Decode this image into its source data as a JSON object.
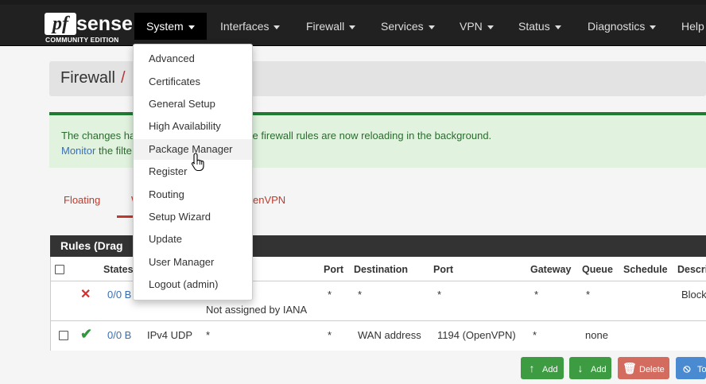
{
  "brand": {
    "logo_pf": "pf",
    "logo_sense": "sense",
    "edition": "COMMUNITY EDITION"
  },
  "nav": {
    "items": [
      {
        "label": "System",
        "active": true
      },
      {
        "label": "Interfaces"
      },
      {
        "label": "Firewall"
      },
      {
        "label": "Services"
      },
      {
        "label": "VPN"
      },
      {
        "label": "Status"
      },
      {
        "label": "Diagnostics"
      },
      {
        "label": "Help"
      }
    ]
  },
  "breadcrumb": {
    "title": "Firewall",
    "separator": "/"
  },
  "alert": {
    "line1_start": "The changes ha",
    "line1_end": "fully. The firewall rules are now reloading in the background.",
    "line2_link": "Monitor",
    "line2_rest": " the filte"
  },
  "tabs": {
    "floating": "Floating",
    "wan_partial": "W",
    "openvpn_partial": "enVPN"
  },
  "rules": {
    "panel_title": "Rules (Drag",
    "headers": {
      "states": "States",
      "port1": "Port",
      "destination": "Destination",
      "port2": "Port",
      "gateway": "Gateway",
      "queue": "Queue",
      "schedule": "Schedule",
      "description": "Descri"
    },
    "rows": [
      {
        "states": "0/0 B",
        "source_note": "Not assigned by IANA",
        "port1": "*",
        "destination": "*",
        "port2": "*",
        "gateway": "*",
        "queue": "*",
        "description": "Block"
      },
      {
        "states": "0/0 B",
        "protocol": "IPv4 UDP",
        "source": "*",
        "port1": "*",
        "destination": "WAN address",
        "port2": "1194 (OpenVPN)",
        "gateway": "*",
        "queue": "none"
      }
    ]
  },
  "buttons": {
    "add_top": "Add",
    "add_bottom": "Add",
    "delete": "Delete",
    "toggle_partial": "To"
  },
  "dropdown": {
    "items": [
      "Advanced",
      "Certificates",
      "General Setup",
      "High Availability",
      "Package Manager",
      "Register",
      "Routing",
      "Setup Wizard",
      "Update",
      "User Manager",
      "Logout (admin)"
    ],
    "hovered": "Package Manager"
  }
}
